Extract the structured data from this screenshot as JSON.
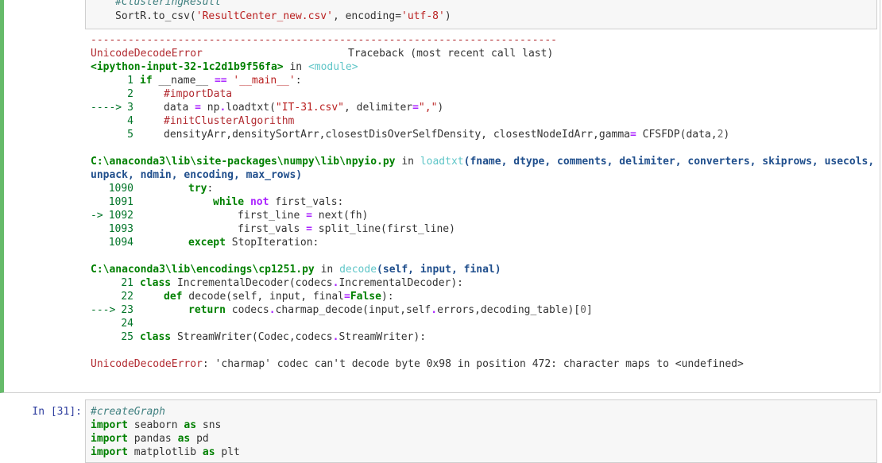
{
  "cell1": {
    "input_lines": [
      "#ClusteringResult",
      "SortR.to_csv('ResultCenter_new.csv', encoding='utf-8')"
    ],
    "traceback": {
      "separator": "---------------------------------------------------------------------------",
      "error_name": "UnicodeDecodeError",
      "header_right": "Traceback (most recent call last)",
      "frame1": {
        "location": "<ipython-input-32-1c2d1b9f56fa>",
        "in_word": "in",
        "func": "<module>",
        "lines": [
          {
            "marker": "",
            "no": "1",
            "code": "if __name__ == '__main__':"
          },
          {
            "marker": "",
            "no": "2",
            "code": "    #importData"
          },
          {
            "marker": "---->",
            "no": "3",
            "code": "    data = np.loadtxt(\"IT-31.csv\", delimiter=\",\")"
          },
          {
            "marker": "",
            "no": "4",
            "code": "    #initClusterAlgorithm"
          },
          {
            "marker": "",
            "no": "5",
            "code": "    densityArr,densitySortArr,closestDisOverSelfDensity, closestNodeIdArr,gamma= CFSFDP(data,2)"
          }
        ]
      },
      "frame2": {
        "location": "C:\\anaconda3\\lib\\site-packages\\numpy\\lib\\npyio.py",
        "in_word": "in",
        "func": "loadtxt",
        "args1": "(fname, dtype, comments, delimiter, converters, skiprows, usecols,",
        "args2": "unpack, ndmin, encoding, max_rows)",
        "lines": [
          {
            "marker": "",
            "no": "1090",
            "code": "        try:"
          },
          {
            "marker": "",
            "no": "1091",
            "code": "            while not first_vals:"
          },
          {
            "marker": "->",
            "no": "1092",
            "code": "                first_line = next(fh)"
          },
          {
            "marker": "",
            "no": "1093",
            "code": "                first_vals = split_line(first_line)"
          },
          {
            "marker": "",
            "no": "1094",
            "code": "        except StopIteration:"
          }
        ]
      },
      "frame3": {
        "location": "C:\\anaconda3\\lib\\encodings\\cp1251.py",
        "in_word": "in",
        "func": "decode",
        "args": "(self, input, final)",
        "lines": [
          {
            "marker": "",
            "no": "21",
            "code": "class IncrementalDecoder(codecs.IncrementalDecoder):"
          },
          {
            "marker": "",
            "no": "22",
            "code": "    def decode(self, input, final=False):"
          },
          {
            "marker": "--->",
            "no": "23",
            "code": "        return codecs.charmap_decode(input,self.errors,decoding_table)[0]"
          },
          {
            "marker": "",
            "no": "24",
            "code": ""
          },
          {
            "marker": "",
            "no": "25",
            "code": "class StreamWriter(Codec,codecs.StreamWriter):"
          }
        ]
      },
      "final_error": "UnicodeDecodeError",
      "final_message": ": 'charmap' codec can't decode byte 0x98 in position 472: character maps to <undefined>"
    }
  },
  "cell2": {
    "prompt": "In [31]:",
    "lines": [
      "#createGraph",
      "import seaborn as sns",
      "import pandas as pd",
      "import matplotlib as plt"
    ]
  }
}
